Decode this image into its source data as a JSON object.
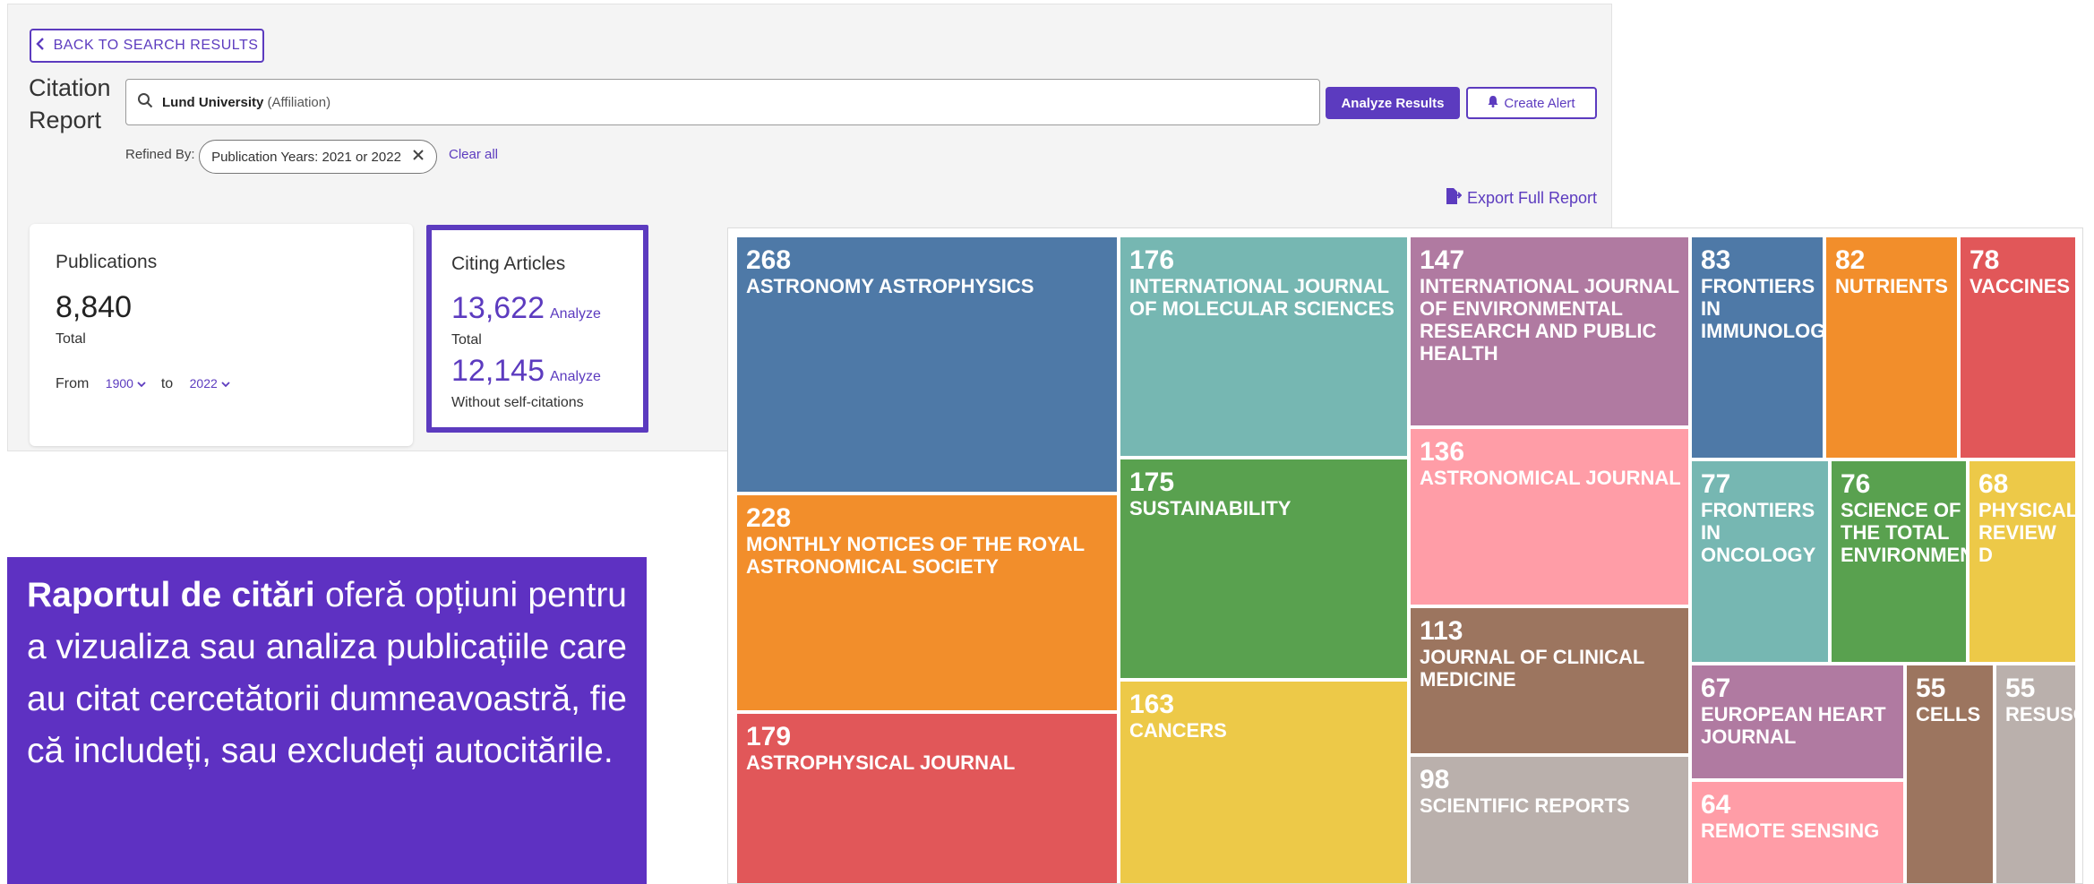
{
  "header": {
    "back_label": "BACK TO SEARCH RESULTS",
    "title_line1": "Citation",
    "title_line2": "Report",
    "search_query": "Lund University",
    "search_field": "(Affiliation)",
    "analyze_label": "Analyze Results",
    "alert_label": "Create Alert",
    "refined_by_label": "Refined By:",
    "refine_chip": "Publication Years: 2021 or 2022",
    "clear_label": "Clear all",
    "export_label": "Export Full Report"
  },
  "publications_card": {
    "title": "Publications",
    "count": "8,840",
    "count_label": "Total",
    "from_label": "From",
    "from_value": "1900",
    "to_label": "to",
    "to_value": "2022"
  },
  "citing_card": {
    "title": "Citing Articles",
    "total": "13,622",
    "total_label": "Total",
    "without_self": "12,145",
    "without_self_label": "Without self-citations",
    "analyze_link": "Analyze"
  },
  "info_box": {
    "bold": "Raportul de citări",
    "rest": " oferă opțiuni pentru a vizualiza sau analiza publicațiile care au citat cercetătorii dumneavoastră, fie că includeți, sau excludeți autocitările."
  },
  "treemap": [
    {
      "count": "268",
      "label": "ASTRONOMY ASTROPHYSICS",
      "color": "#4e79a7"
    },
    {
      "count": "228",
      "label": "MONTHLY NOTICES OF THE ROYAL ASTRONOMICAL SOCIETY",
      "color": "#f28e2b"
    },
    {
      "count": "179",
      "label": "ASTROPHYSICAL JOURNAL",
      "color": "#e15759"
    },
    {
      "count": "176",
      "label": "INTERNATIONAL JOURNAL OF MOLECULAR SCIENCES",
      "color": "#76b7b2"
    },
    {
      "count": "175",
      "label": "SUSTAINABILITY",
      "color": "#59a14f"
    },
    {
      "count": "163",
      "label": "CANCERS",
      "color": "#edc948"
    },
    {
      "count": "147",
      "label": "INTERNATIONAL JOURNAL OF ENVIRONMENTAL RESEARCH AND PUBLIC HEALTH",
      "color": "#b07aa1"
    },
    {
      "count": "136",
      "label": "ASTRONOMICAL JOURNAL",
      "color": "#ff9da7"
    },
    {
      "count": "113",
      "label": "JOURNAL OF CLINICAL MEDICINE",
      "color": "#9c755f"
    },
    {
      "count": "98",
      "label": "SCIENTIFIC REPORTS",
      "color": "#bab0ac"
    },
    {
      "count": "83",
      "label": "FRONTIERS IN IMMUNOLOGY",
      "color": "#4e79a7"
    },
    {
      "count": "82",
      "label": "NUTRIENTS",
      "color": "#f28e2b"
    },
    {
      "count": "78",
      "label": "VACCINES",
      "color": "#e15759"
    },
    {
      "count": "77",
      "label": "FRONTIERS IN ONCOLOGY",
      "color": "#76b7b2"
    },
    {
      "count": "76",
      "label": "SCIENCE OF THE TOTAL ENVIRONMENT",
      "color": "#59a14f"
    },
    {
      "count": "68",
      "label": "PHYSICAL REVIEW D",
      "color": "#edc948"
    },
    {
      "count": "67",
      "label": "EUROPEAN HEART JOURNAL",
      "color": "#b07aa1"
    },
    {
      "count": "55",
      "label": "CELLS",
      "color": "#9c755f"
    },
    {
      "count": "55",
      "label": "RESUSCITATION",
      "color": "#bab0ac"
    },
    {
      "count": "64",
      "label": "REMOTE SENSING",
      "color": "#ff9da7"
    }
  ]
}
